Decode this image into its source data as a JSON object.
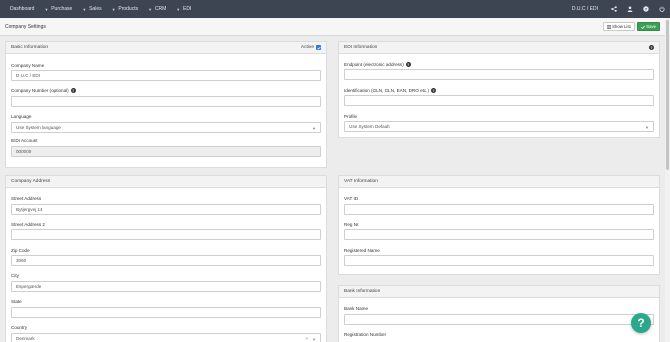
{
  "nav": {
    "items": [
      {
        "label": "Dashboard",
        "caret": true
      },
      {
        "label": "Purchase",
        "caret": true
      },
      {
        "label": "Sales",
        "caret": true
      },
      {
        "label": "Products",
        "caret": true
      },
      {
        "label": "CRM",
        "caret": true
      },
      {
        "label": "EDI",
        "caret": false
      }
    ],
    "company": "D.U.C / EDI",
    "icons": [
      "share-icon",
      "user-icon",
      "help-icon",
      "power-icon"
    ]
  },
  "titlebar": {
    "title": "Company Settings",
    "show_list_label": "Show List",
    "save_label": "Save"
  },
  "basic": {
    "heading": "Basic Information",
    "active_label": "Active",
    "company_name_label": "Company Name",
    "company_name_value": "D.U.C / EDI",
    "company_number_label": "Company Number (optional)",
    "company_number_value": "",
    "language_label": "Language",
    "language_value": "Use System language",
    "iedi_label": "IEDI Account",
    "iedi_value": "000000"
  },
  "edi": {
    "heading": "EDI Information",
    "endpoint_label": "Endpoint (electronic address)",
    "endpoint_value": "",
    "identification_label": "Identification (GLN, GLN, EAN, DRO etc.)",
    "identification_value": "",
    "profile_label": "Profile",
    "profile_value": "Use System Default"
  },
  "address": {
    "heading": "Company Address",
    "street_label": "Street Address",
    "street_value": "Bytjergvej 14",
    "street2_label": "Street Address 2",
    "street2_value": "",
    "zip_label": "Zip Code",
    "zip_value": "3060",
    "city_label": "City",
    "city_value": "Espergærde",
    "state_label": "State",
    "state_value": "",
    "country_label": "Country",
    "country_value": "Denmark"
  },
  "vat": {
    "heading": "VAT Information",
    "vat_id_label": "VAT ID",
    "vat_id_value": "",
    "reg_nr_label": "Reg Nr.",
    "reg_nr_value": "",
    "registered_name_label": "Registered Name",
    "registered_name_value": ""
  },
  "bank": {
    "heading": "Bank Information",
    "bank_name_label": "Bank Name",
    "bank_name_value": "",
    "registration_number_label": "Registration Number"
  },
  "fab": {
    "label": "?"
  },
  "colors": {
    "nav_bg": "#3d4452",
    "save_green": "#3c9f55",
    "fab_teal": "#2aa889",
    "checkbox_blue": "#2d7ad6"
  }
}
